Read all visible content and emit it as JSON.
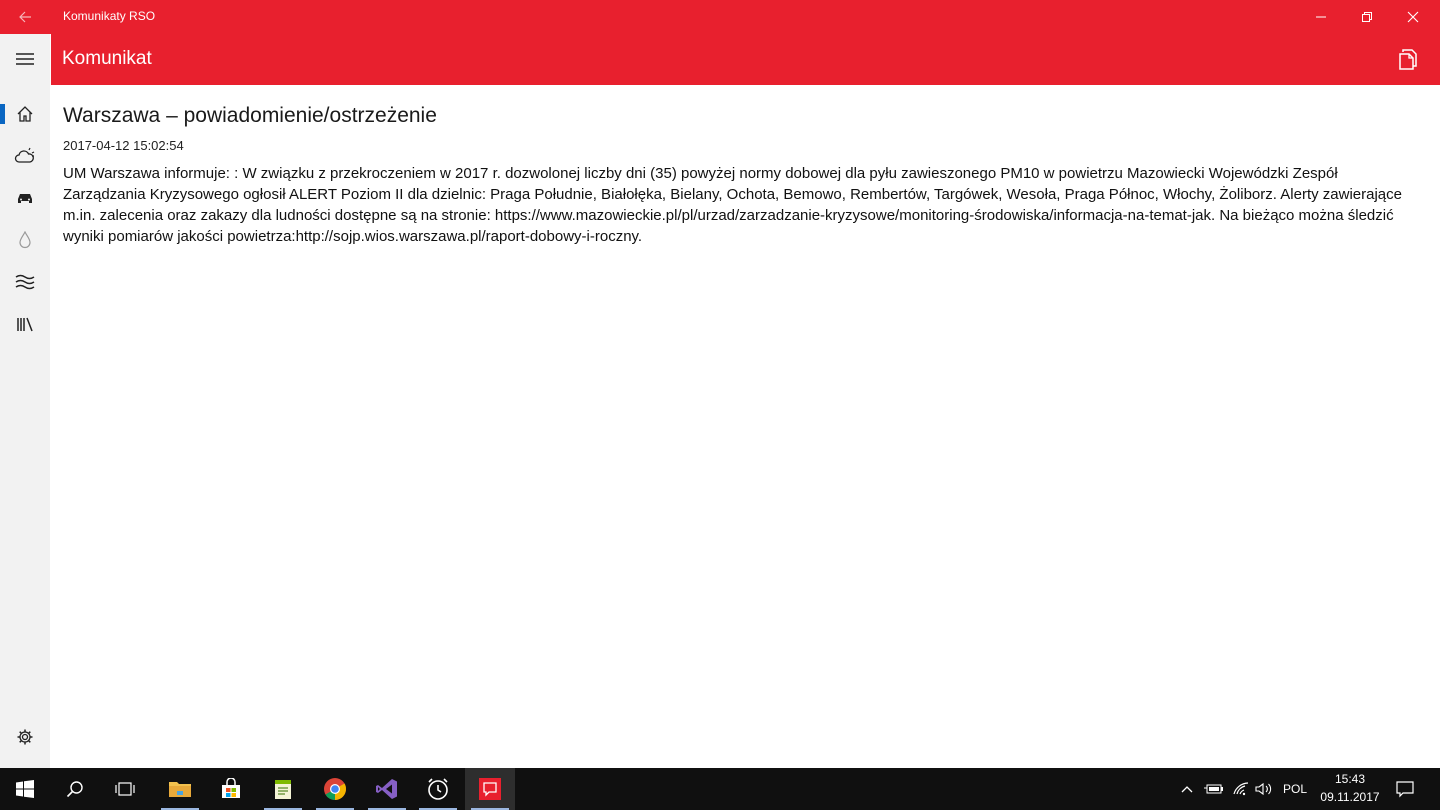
{
  "window": {
    "title": "Komunikaty RSO"
  },
  "header": {
    "title": "Komunikat"
  },
  "nav": {
    "items": [
      {
        "icon": "home-icon"
      },
      {
        "icon": "weather-icon"
      },
      {
        "icon": "car-icon"
      },
      {
        "icon": "water-drop-icon"
      },
      {
        "icon": "waves-icon"
      },
      {
        "icon": "library-icon"
      }
    ],
    "settings_icon": "gear-icon"
  },
  "message": {
    "title": "Warszawa – powiadomienie/ostrzeżenie",
    "date": "2017-04-12 15:02:54",
    "body": "UM Warszawa informuje: : W związku z przekroczeniem w 2017 r. dozwolonej liczby dni (35) powyżej normy dobowej dla pyłu zawieszonego PM10 w powietrzu Mazowiecki Wojewódzki Zespół Zarządzania Kryzysowego ogłosił ALERT Poziom II dla dzielnic: Praga Południe, Białołęka, Bielany, Ochota, Bemowo, Rembertów, Targówek, Wesoła, Praga Północ, Włochy, Żoliborz. Alerty zawierające m.in. zalecenia oraz zakazy dla ludności dostępne są na stronie: https://www.mazowieckie.pl/pl/urzad/zarzadzanie-kryzysowe/monitoring-środowiska/informacja-na-temat-jak. Na bieżąco można śledzić wyniki pomiarów jakości powietrza:http://sojp.wios.warszawa.pl/raport-dobowy-i-roczny."
  },
  "taskbar": {
    "language": "POL",
    "time": "15:43",
    "date": "09.11.2017"
  },
  "colors": {
    "accent": "#e8202e",
    "rail": "#f2f2f2",
    "taskbar": "#101010"
  }
}
